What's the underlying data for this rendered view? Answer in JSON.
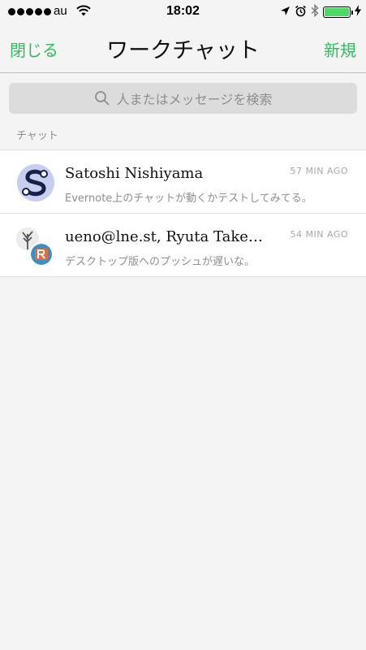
{
  "status_bar": {
    "carrier": "au",
    "time": "18:02",
    "battery_level": 1.0
  },
  "nav": {
    "close_label": "閉じる",
    "title": "ワークチャット",
    "new_label": "新規",
    "accent_color": "#2dbe60"
  },
  "search": {
    "placeholder": "人またはメッセージを検索"
  },
  "section": {
    "header": "チャット"
  },
  "chats": [
    {
      "name": "Satoshi Nishiyama",
      "time": "57 MIN AGO",
      "preview": "Evernote上のチャットが動くかテストしてみてる。",
      "avatar": "monogram-s-avatar"
    },
    {
      "name": "ueno@lne.st, Ryuta Take…",
      "time": "54 MIN AGO",
      "preview": "デスクトップ版へのプッシュが遅いな。",
      "avatar": "group-avatar"
    }
  ]
}
